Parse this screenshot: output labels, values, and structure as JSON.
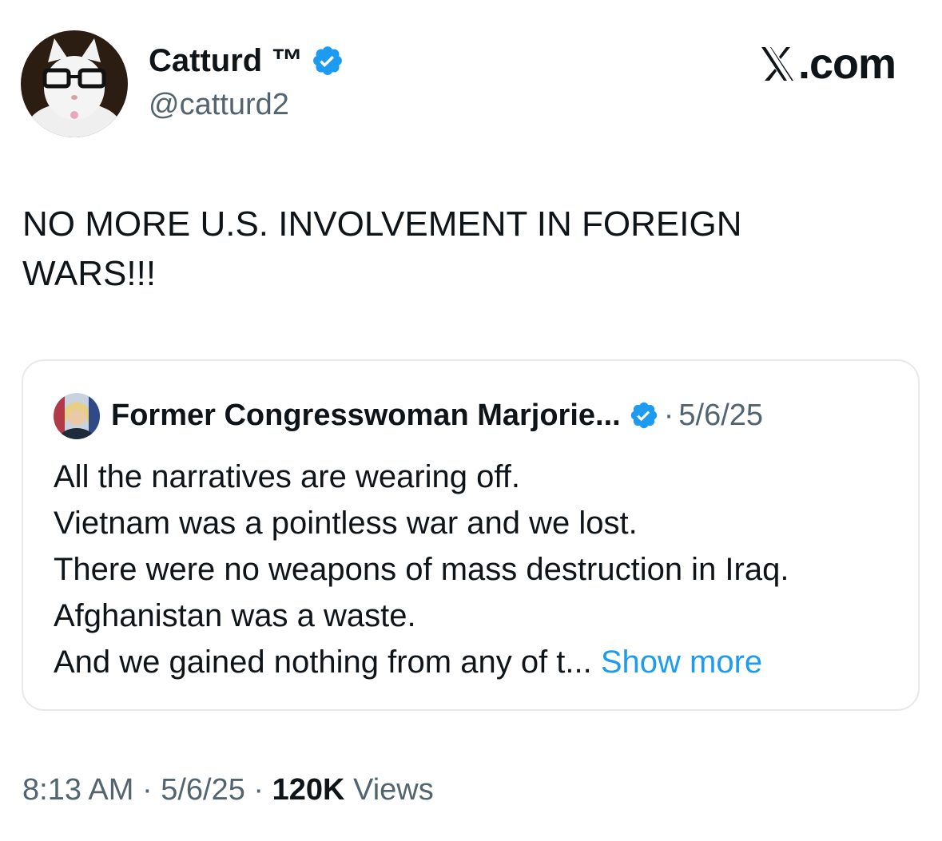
{
  "author": {
    "display_name": "Catturd ™",
    "handle": "@catturd2",
    "verified": true
  },
  "brand": {
    "label": ".com",
    "icon": "x-logo-icon"
  },
  "tweet": {
    "text": "NO MORE U.S. INVOLVEMENT IN FOREIGN WARS!!!"
  },
  "quoted_tweet": {
    "author_name": "Former Congresswoman Marjorie...",
    "separator": "·",
    "date": "5/6/25",
    "lines": [
      "All the narratives are wearing off.",
      "Vietnam was a pointless war and we lost.",
      "There were no weapons of mass destruction in Iraq.",
      "Afghanistan was a waste.",
      "And we gained nothing from any of t..."
    ],
    "show_more_label": "Show more"
  },
  "footer": {
    "time": "8:13 AM",
    "sep1": "·",
    "date": "5/6/25",
    "sep2": "·",
    "views_count": "120K",
    "views_label": "Views"
  },
  "colors": {
    "verified_blue": "#1d9bf0",
    "text_primary": "#0f1419",
    "text_secondary": "#536471",
    "border": "#e6e9ec"
  }
}
